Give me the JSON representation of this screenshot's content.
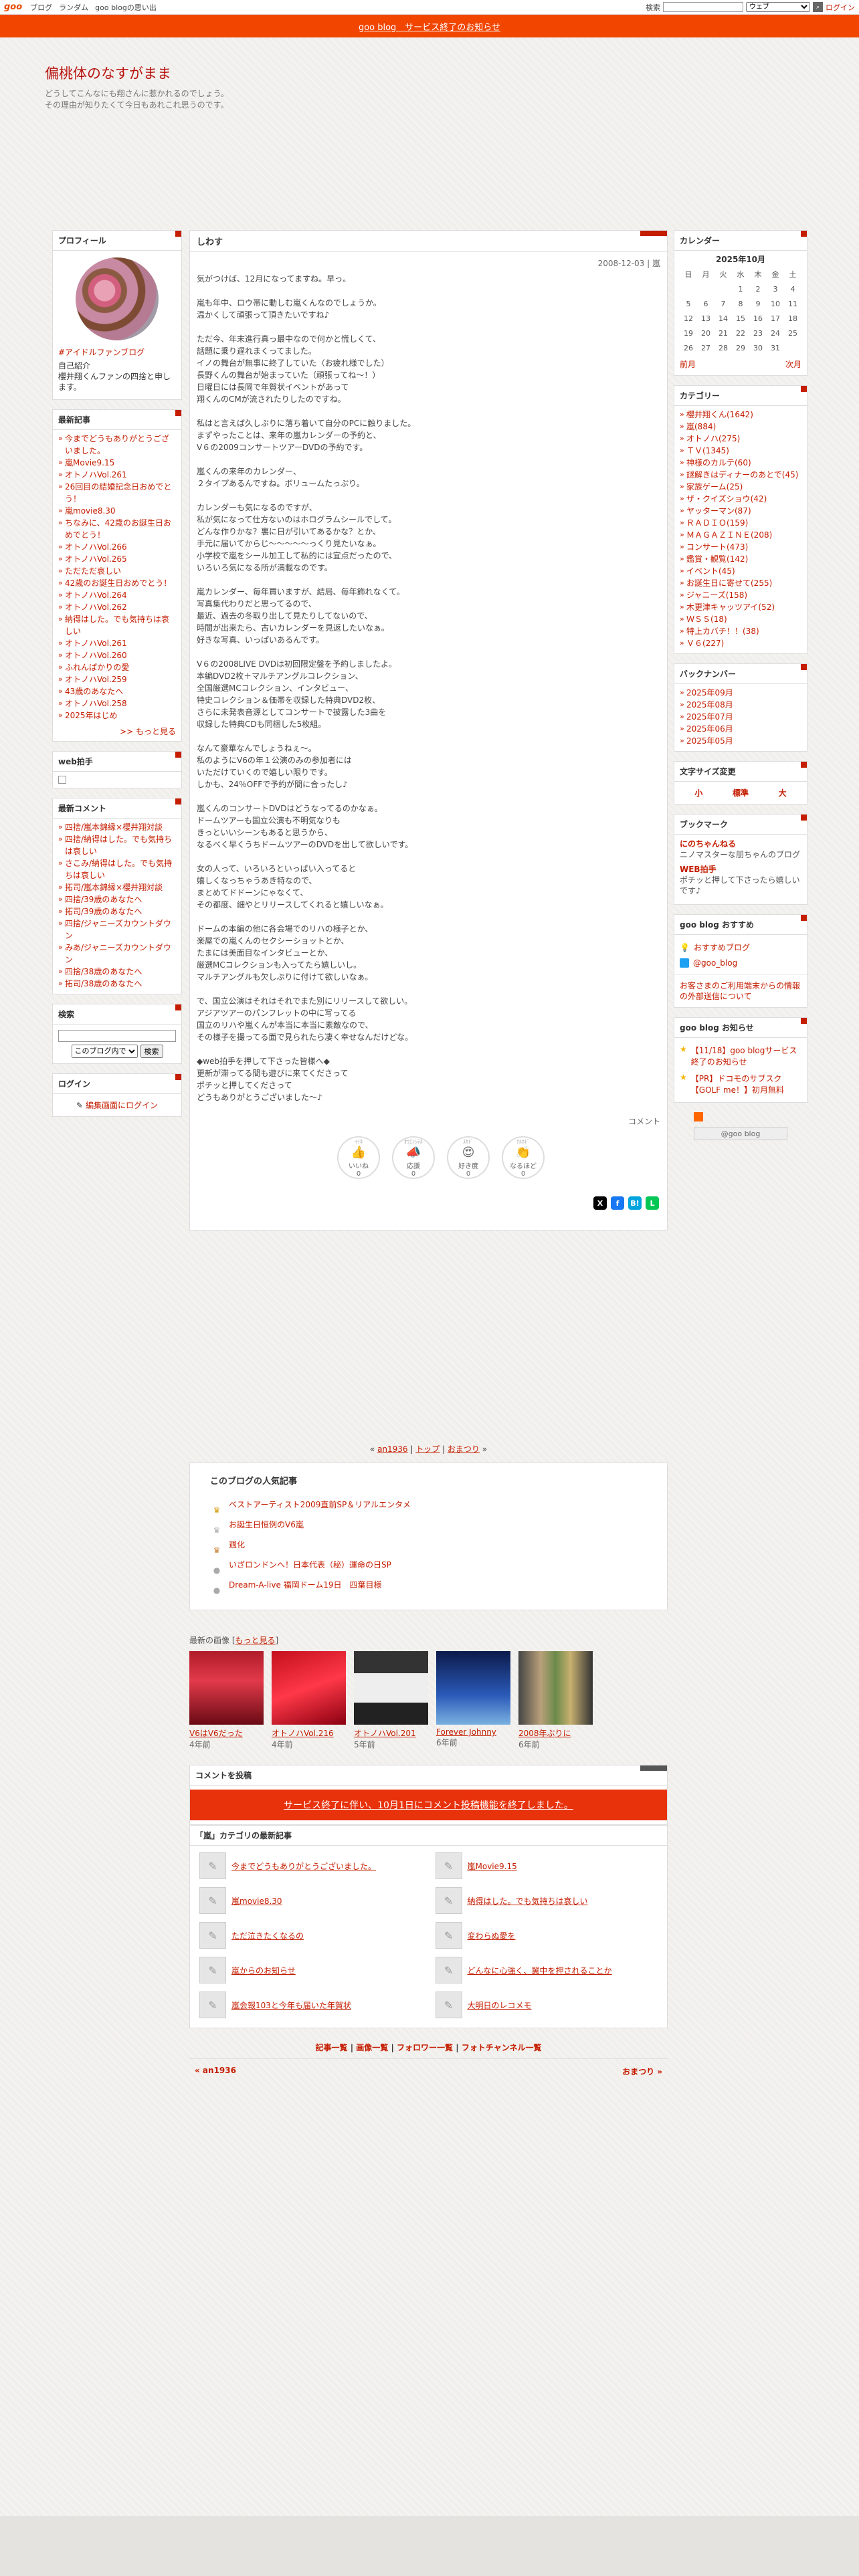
{
  "topbar": {
    "logo": "goo",
    "links": [
      "ブログ",
      "ランダム",
      "goo blogの思い出"
    ],
    "search_label": "検索",
    "search_value": "",
    "search_select": "ウェブ",
    "login": "ログイン"
  },
  "notice": "goo blog　サービス終了のお知らせ",
  "blog": {
    "title": "偏桃体のなすがまま",
    "desc1": "どうしてこんなにも翔さんに惹かれるのでしょう。",
    "desc2": "その理由が知りたくて今日もあれこれ思うのです。"
  },
  "profile": {
    "title": "プロフィール",
    "hashtag": "#アイドルファンブログ",
    "intro_label": "自己紹介",
    "intro": "櫻井翔くんファンの四捨と申します。"
  },
  "recent": {
    "title": "最新記事",
    "items": [
      "今までどうもありがとうございました。",
      "嵐Movie9.15",
      "オトノハVol.261",
      "26回目の結婚記念日おめでとう！",
      "嵐movie8.30",
      "ちなみに、42歳のお誕生日おめでとう！",
      "オトノハVol.266",
      "オトノハVol.265",
      "ただただ哀しい",
      "42歳のお誕生日おめでとう！",
      "オトノハVol.264",
      "オトノハVol.262",
      "納得はした。でも気持ちは哀しい",
      "オトノハVol.261",
      "オトノハVol.260",
      "ふれんぱかりの愛",
      "オトノハVol.259",
      "43歳のあなたへ",
      "オトノハVol.258",
      "2025年はじめ"
    ],
    "more": ">> もっと見る"
  },
  "webclap": {
    "title": "web拍手"
  },
  "comments": {
    "title": "最新コメント",
    "items": [
      "四捨/嵐本錦縁×櫻井翔対談",
      "四捨/納得はした。でも気持ちは哀しい",
      "さこみ/納得はした。でも気持ちは哀しい",
      "拓司/嵐本錦縁×櫻井翔対談",
      "四捨/39歳のあなたへ",
      "拓司/39歳のあなたへ",
      "四捨/ジャニーズカウントダウン",
      "みあ/ジャニーズカウントダウン",
      "四捨/38歳のあなたへ",
      "拓司/38歳のあなたへ"
    ]
  },
  "search": {
    "title": "検索",
    "select": "このブログ内で",
    "button": "検索"
  },
  "login": {
    "title": "ログイン",
    "link": "編集画面にログイン"
  },
  "article": {
    "heading": "しわす",
    "date": "2008-12-03 | 嵐",
    "paragraphs": [
      "気がつけば、12月になってますね。早っ。",
      "嵐も年中、ロウ帯に動しむ嵐くんなのでしょうか。\n温かくして頑張って頂きたいですね♪",
      "ただ今、年末進行真っ最中なので何かと慌しくて、\n話題に乗り遅れまくってました。\nイノの舞台が無事に終了していた（お疲れ様でした）\n長野くんの舞台が始まっていた（頑張ってね～！）\n日曜日には長岡で年賀状イベントがあって\n翔くんのCMが流されたりしたのですね。",
      "私はと言えば久しぶりに落ち着いて自分のPCに触りました。\nまずやったことは、来年の嵐カレンダーの予約と、\nV６の2009コンサートツアーDVDの予約です。",
      "嵐くんの来年のカレンダー、\n２タイプあるんですね。ボリュームたっぷり。",
      "カレンダーも気になるのですが、\n私が気になって仕方ないのはホログラムシールでして。\nどんな作りかな？裏に日が引いてあるかな？とか、\n手元に届いてからじ～～～～～っくり見たいなぁ。\n小学校で嵐をシール加工して私的には宜点だったので、\nいろいろ気になる所が満載なのです。",
      "嵐カレンダー、毎年買いますが、結局、毎年飾れなくて。\n写真集代わりだと思ってるので、\n最近、過去の冬取り出して見たりしてないので、\n時間が出来たら、古いカレンダーを見返したいなぁ。\n好きな写真、いっぱいあるんです。",
      "",
      "V６の2008LIVE DVDは初回限定盤を予約しましたよ。\n本編DVD2枚＋マルチアングルコレクション、\n全国厳選MCコレクション、インタビュー、\n特史コレクション＆価帯を収録した特典DVD2枚、\nさらに未発表音源としてコンサートで披露した3曲を\n収録した特典CDも同梱した5枚組。",
      "なんて豪華なんでしょうねぇ～。\n私のようにV6の年１公演のみの参加者には\nいただけていくので嬉しい限りです。\nしかも、24％OFFで予約が間に合ったし♪",
      "嵐くんのコンサートDVDはどうなってるのかなぁ。\nドームツアーも国立公演も不明気なりも\nきっといいシーンもあると思うから、\nなるべく早くうちドームツアーのDVDを出して欲しいです。",
      "女の人って、いろいろといっぱい入ってると\n嬉しくなっちゃうあき特なので、\nまとめてドドーンにゃなくて、\nその都度、細やとリリースしてくれると嬉しいなぁ。",
      "ドームの本編の他に各会場でのリハの様子とか、\n楽屋での嵐くんのセクシーショットとか、\nたまには美面目なインタビューとか、\n厳選MCコレクションも入ってたら嬉しいし。\nマルチアングルも欠しぷりに付けて欲しいなぁ。",
      "で、国立公演はそれはそれでまた別にリリースして欲しい。\nアジアツアーのパンフレットの中に写ってる\n国立のリハや嵐くんが本当に本当に素敵なので、\nその様子を撮ってる面で見られたら凄く幸せなんだけどな。",
      "◆web拍手を押して下さった皆様へ◆\n更新が滞ってる間も遊びに来てくださって\nポチッと押してくださって\nどうもありがとうございました～♪"
    ],
    "comment_label": "コメント",
    "reactions": [
      {
        "label": "いいね",
        "count": "0",
        "top": "ｲｲﾈ",
        "emoji": "👍"
      },
      {
        "label": "応援",
        "count": "0",
        "top": "ｵｳｴﾝｼﾃﾙ",
        "emoji": "📣"
      },
      {
        "label": "好き度",
        "count": "0",
        "top": "ｽｷﾄﾞ",
        "emoji": "😍"
      },
      {
        "label": "なるほど",
        "count": "0",
        "top": "ﾅﾙﾎﾄﾞ",
        "emoji": "👏"
      }
    ],
    "share": [
      "X",
      "f",
      "B!",
      "L"
    ]
  },
  "pagenav": {
    "prev": "an1936",
    "top": "トップ",
    "next": "おまつり"
  },
  "popular": {
    "title": "このブログの人気記事",
    "items": [
      "ベストアーティスト2009直前SP＆リアルエンタメ",
      "お誕生日恒例のV6嵐",
      "週化",
      "いざロンドンへ！日本代表（秘）運命の日SP",
      "Dream-A-live 福岡ドーム19日　四葉目様"
    ]
  },
  "recentimg": {
    "title": "最新の画像",
    "more": "もっと見る",
    "items": [
      {
        "cap": "V6はV6だった",
        "ago": "4年前"
      },
      {
        "cap": "オトノハVol.216",
        "ago": "4年前"
      },
      {
        "cap": "オトノハVol.201",
        "ago": "5年前"
      },
      {
        "cap": "Forever Johnny",
        "ago": "6年前"
      },
      {
        "cap": "2008年ぶりに",
        "ago": "6年前"
      }
    ]
  },
  "commentpost": {
    "title": "コメントを投稿",
    "notice": "サービス終了に伴い、10月1日にコメント投稿機能を終了しました。"
  },
  "category_articles": {
    "title": "「嵐」カテゴリの最新記事",
    "items": [
      "今までどうもありがとうございました。",
      "嵐Movie9.15",
      "嵐movie8.30",
      "納得はした。でも気持ちは哀しい",
      "ただ泣きたくなるの",
      "変わらぬ愛を",
      "嵐からのお知らせ",
      "どんなに心強く、翼中を押されることか",
      "嵐会報103と今年も届いた年賀状",
      "大明日のレコメモ"
    ]
  },
  "footnav": [
    "記事一覧",
    "画像一覧",
    "フォロワー一覧",
    "フォトチャンネル一覧"
  ],
  "prevnext": {
    "prev": "« an1936",
    "next": "おまつり »"
  },
  "calendar": {
    "title": "カレンダー",
    "month": "2025年10月",
    "days": [
      "日",
      "月",
      "火",
      "水",
      "木",
      "金",
      "土"
    ],
    "rows": [
      [
        "",
        "",
        "",
        "1",
        "2",
        "3",
        "4"
      ],
      [
        "5",
        "6",
        "7",
        "8",
        "9",
        "10",
        "11"
      ],
      [
        "12",
        "13",
        "14",
        "15",
        "16",
        "17",
        "18"
      ],
      [
        "19",
        "20",
        "21",
        "22",
        "23",
        "24",
        "25"
      ],
      [
        "26",
        "27",
        "28",
        "29",
        "30",
        "31",
        ""
      ]
    ],
    "prev": "前月",
    "next": "次月"
  },
  "categories": {
    "title": "カテゴリー",
    "items": [
      "櫻井翔くん(1642)",
      "嵐(884)",
      "オトノハ(275)",
      "ＴＶ(1345)",
      "神様のカルテ(60)",
      "謎解きはディナーのあとで(45)",
      "家族ゲーム(25)",
      "ザ・クイズショウ(42)",
      "ヤッターマン(87)",
      "ＲＡＤＩＯ(159)",
      "ＭＡＧＡＺＩＮＥ(208)",
      "コンサート(473)",
      "鑑賞・観覧(142)",
      "イベント(45)",
      "お誕生日に寄せて(255)",
      "ジャニーズ(158)",
      "木更津キャッツアイ(52)",
      "ＷＳＳ(18)",
      "特上カバチ！！(38)",
      "Ｖ６(227)"
    ]
  },
  "backnumber": {
    "title": "バックナンバー",
    "items": [
      "2025年09月",
      "2025年08月",
      "2025年07月",
      "2025年06月",
      "2025年05月"
    ]
  },
  "fontsize": {
    "title": "文字サイズ変更",
    "small": "小",
    "std": "標準",
    "large": "大"
  },
  "bookmark": {
    "title": "ブックマーク",
    "items": [
      {
        "name": "にのちゃんねる",
        "desc": "ニノマスターな朋ちゃんのブログ"
      },
      {
        "name": "WEB拍手",
        "desc": "ポチッと押して下さったら嬉しいです♪"
      }
    ]
  },
  "goorec": {
    "title": "goo blog おすすめ",
    "items": [
      "おすすめブログ",
      "@goo_blog"
    ],
    "text": "お客さまのご利用端末からの情報の外部送信について"
  },
  "gooinfo": {
    "title": "goo blog お知らせ",
    "items": [
      "【11/18】goo blogサービス終了のお知らせ",
      "【PR】ドコモのサブスク【GOLF me！】初月無料"
    ]
  },
  "goobtn": "@goo blog"
}
